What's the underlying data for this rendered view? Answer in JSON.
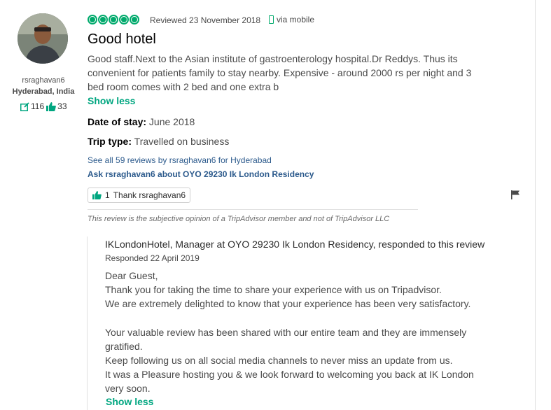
{
  "member": {
    "username": "rsraghavan6",
    "location": "Hyderabad, India",
    "review_count": "116",
    "helpful_count": "33"
  },
  "review": {
    "rating": 5,
    "rating_color": "#00aa6c",
    "reviewed_date": "Reviewed 23 November 2018",
    "via": "via mobile",
    "title": "Good hotel",
    "text": "Good staff.Next to the Asian institute of gastroenterology hospital.Dr Reddys. Thus its convenient for patients family to stay nearby. Expensive - around 2000 rs per night and 3 bed room comes with 2 bed and one extra b",
    "show_less": "Show less",
    "date_of_stay_label": "Date of stay:",
    "date_of_stay_value": "June 2018",
    "trip_type_label": "Trip type:",
    "trip_type_value": "Travelled on business",
    "see_all_link": "See all 59 reviews by rsraghavan6 for Hyderabad",
    "ask_link": "Ask rsraghavan6 about OYO 29230 Ik London Residency",
    "thank_count": "1",
    "thank_label": "Thank rsraghavan6",
    "disclaimer": "This review is the subjective opinion of a TripAdvisor member and not of TripAdvisor LLC"
  },
  "response": {
    "header": "IKLondonHotel, Manager at OYO 29230 Ik London Residency, responded to this review",
    "date": "Responded 22 April 2019",
    "line1": "Dear Guest,",
    "line2": "Thank you for taking the time to share your experience with us on Tripadvisor.",
    "line3": "We are extremely delighted to know that your experience has been very satisfactory.",
    "line4": "Your valuable review has been shared with our entire team and they are immensely gratified.",
    "line5": "Keep following us on all social media channels to never miss an update from us.",
    "line6": "It was a Pleasure hosting you & we look forward to welcoming you back at IK London very soon.",
    "show_less": "Show less"
  },
  "colors": {
    "accent_green": "#00a680",
    "link_blue": "#2c5a8c"
  }
}
